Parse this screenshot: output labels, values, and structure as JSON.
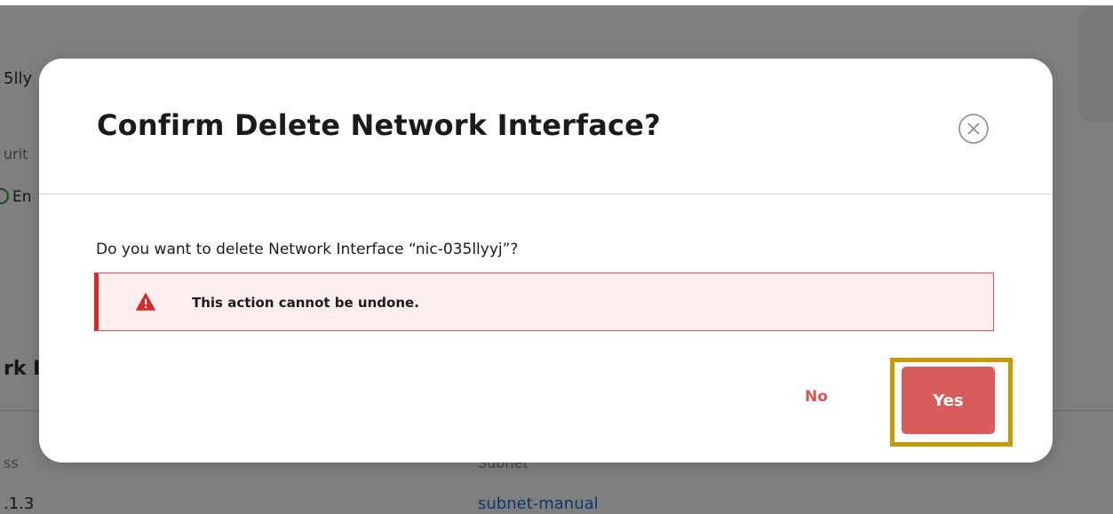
{
  "background": {
    "resource_id_fragment": "5lly",
    "security_label_fragment": "urit",
    "status_fragment": "En",
    "section_title_fragment": "rk I",
    "ip_label_fragment": "ss",
    "subnet_label": "Subnet",
    "ip_value_fragment": ".1.3",
    "subnet_value": "subnet-manual"
  },
  "dialog": {
    "title": "Confirm Delete Network Interface?",
    "prompt": "Do you want to delete Network Interface “nic-035llyyj”?",
    "warning": "This action cannot be undone.",
    "no_label": "No",
    "yes_label": "Yes",
    "close_icon": "close-circle-icon",
    "warning_icon": "warning-triangle-icon"
  },
  "colors": {
    "danger": "#d85c5c",
    "alert_border": "#d42a2a",
    "alert_bg": "#fdeeee",
    "highlight": "#c49a00",
    "link": "#1f6fd1",
    "status_green": "#2e9b3b"
  }
}
